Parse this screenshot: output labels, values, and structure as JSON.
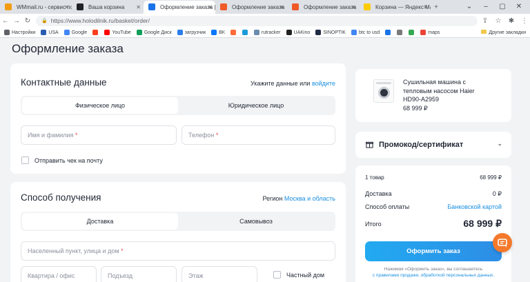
{
  "browser": {
    "tabs": [
      {
        "title": "WMmail.ru - сервис по",
        "color": "#f39c12",
        "active": false
      },
      {
        "title": "Ваша корзина",
        "color": "#202124",
        "active": false
      },
      {
        "title": "Оформление заказа | r",
        "color": "#1a73e8",
        "active": true
      },
      {
        "title": "Оформление заказа",
        "color": "#f05a28",
        "active": false
      },
      {
        "title": "Оформление заказа",
        "color": "#f05a28",
        "active": false
      },
      {
        "title": "Корзина — Яндекс Ма",
        "color": "#ffcc00",
        "active": false
      }
    ],
    "url": "https://www.holodilnik.ru/basket/order/",
    "bookmarks": [
      {
        "label": "Настройки",
        "color": "#5f6368"
      },
      {
        "label": "USA",
        "color": "#2a5db0"
      },
      {
        "label": "Google",
        "color": "#4285f4"
      },
      {
        "label": "",
        "color": "#fc3f1d"
      },
      {
        "label": "YouTube",
        "color": "#ff0000"
      },
      {
        "label": "Google Диск",
        "color": "#0f9d58"
      },
      {
        "label": "загрузчик",
        "color": "#2b7de9"
      },
      {
        "label": "ВК",
        "color": "#0077ff"
      },
      {
        "label": "",
        "color": "#ff6c37"
      },
      {
        "label": "",
        "color": "#1b9bd8"
      },
      {
        "label": "rutracker",
        "color": "#6a8caf"
      },
      {
        "label": "UAKino",
        "color": "#222222"
      },
      {
        "label": "SINOPTIK",
        "color": "#1f2b44"
      },
      {
        "label": "btc to usd",
        "color": "#4285f4"
      },
      {
        "label": "",
        "color": "#1a73e8"
      },
      {
        "label": "",
        "color": "#7a7a7a"
      },
      {
        "label": "",
        "color": "#34a853"
      },
      {
        "label": "maps",
        "color": "#ea4335"
      }
    ],
    "other_bookmarks": "Другие закладки"
  },
  "page": {
    "title": "Оформление заказа",
    "contacts": {
      "title": "Контактные данные",
      "hint_prefix": "Укажите данные или",
      "hint_link": "войдите",
      "tab_individual": "Физическое лицо",
      "tab_legal": "Юридическое лицо",
      "name_placeholder": "Имя и фамилия",
      "phone_placeholder": "Телефон",
      "required_mark": "*",
      "receipt_label": "Отправить чек на почту"
    },
    "delivery": {
      "title": "Способ получения",
      "region_label": "Регион",
      "region_link": "Москва и область",
      "tab_delivery": "Доставка",
      "tab_pickup": "Самовывоз",
      "address_placeholder": "Населенный пункт, улица и дом",
      "apartment_placeholder": "Квартира / офис",
      "entrance_placeholder": "Подъезд",
      "floor_placeholder": "Этаж",
      "private_house_label": "Частный дом"
    },
    "product": {
      "name": "Сушильная машина с тепловым насосом Haier HD90-A2959",
      "price": "68 999 ₽"
    },
    "promo": {
      "title": "Промокод/сертификат"
    },
    "summary": {
      "items_label": "1 товар",
      "items_value": "68 999 ₽",
      "delivery_label": "Доставка",
      "delivery_value": "0 ₽",
      "payment_label": "Способ оплаты",
      "payment_value": "Банковской картой",
      "total_label": "Итого",
      "total_value": "68 999 ₽",
      "checkout_button": "Оформить заказ",
      "legal_line1": "Нажимая «Оформить заказ», вы соглашаетесь",
      "legal_line2": "с правилами продажи, обработкой персональных данных."
    }
  },
  "colors": {
    "accent": "#1a8fe0",
    "cta": "#2a9ded",
    "chat": "#f4792b",
    "required": "#f04a4a"
  }
}
